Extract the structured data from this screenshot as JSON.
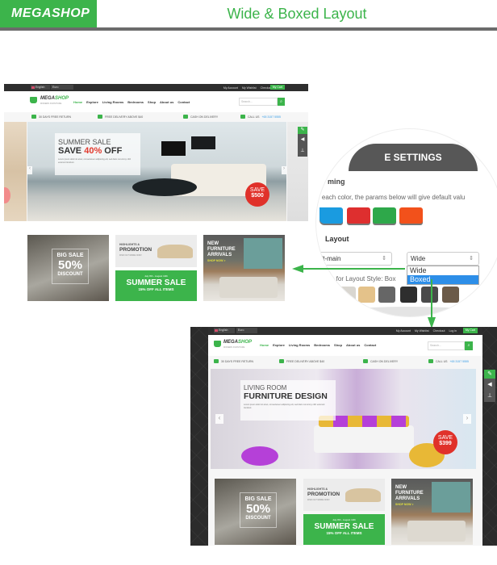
{
  "banner": {
    "logo": "MEGASHOP",
    "title": "Wide & Boxed Layout"
  },
  "shop": {
    "language": "English",
    "currency": "Euro",
    "top_links": [
      "My Account",
      "My Wishlist",
      "Checkout",
      "Log in"
    ],
    "cart_label": "My Cart",
    "logo_main": "MEGA",
    "logo_accent": "SHOP",
    "logo_sub": "MODERN FURNITURE",
    "menu": [
      "Home",
      "Explore",
      "Living Rooms",
      "Bedrooms",
      "Shop",
      "About us",
      "Contact"
    ],
    "search_placeholder": "Search...",
    "features": {
      "returns": "30 DAYS FREE RETURN",
      "delivery": "FREE DELIVERY ABOVE $40",
      "cash": "CASH ON DELIVERY",
      "call_label": "CALL US",
      "call_number": "+65 3157 5555"
    },
    "lorem": "Lorem ipsum dolor sit amet, consectetuer adipiscing elit, sed diam nonummy nibh euismod tincidunt.",
    "promos": {
      "big_sale_1": "BIG SALE",
      "big_sale_2": "50%",
      "big_sale_3": "DISCOUNT",
      "highlights_1": "HIGHLIGHTS &",
      "highlights_2": "PROMOTION",
      "highlights_3": "FIND OUT MORE NOW!",
      "sale_dates": "July 8th - August 10th",
      "sale_title": "SUMMER SALE",
      "sale_sub": "15% OFF ALL ITEMS",
      "new_1": "NEW",
      "new_2": "FURNITURE",
      "new_3": "ARRIVALS",
      "shop_now": "SHOP NOW >"
    }
  },
  "wide_slide": {
    "sub": "SUMMER SALE",
    "main_prefix": "SAVE ",
    "main_accent": "40%",
    "main_suffix": " OFF",
    "badge_top": "SAVE",
    "badge_value": "$500"
  },
  "boxed_slide": {
    "sub": "LIVING ROOM",
    "main": "FURNITURE DESIGN",
    "badge_top": "SAVE",
    "badge_value": "$399"
  },
  "settings": {
    "header": "E SETTINGS",
    "theming_label": "ming",
    "theming_desc": "r each color, the params below will give default valu",
    "swatches": [
      "#1a9be0",
      "#de2f2f",
      "#2ea84a",
      "#f2511b"
    ],
    "layout_label": "Layout",
    "position_value": "ft-main",
    "layout_value": "Wide",
    "layout_options": [
      "Wide",
      "Boxed"
    ],
    "layout_selected": "Boxed",
    "bg_desc": "ns for Layout Style: Box",
    "bg_thumbs": [
      "#d9d6d0",
      "#e4c28a",
      "#666666",
      "#2e2e2e",
      "#4a4a4a",
      "#6b5a48"
    ]
  },
  "colors": {
    "accent": "#3cb44b",
    "sale_red": "#e0312a",
    "dark": "#2e2e2e",
    "link_blue": "#3a9ee6",
    "select_blue": "#2d8ee8"
  }
}
